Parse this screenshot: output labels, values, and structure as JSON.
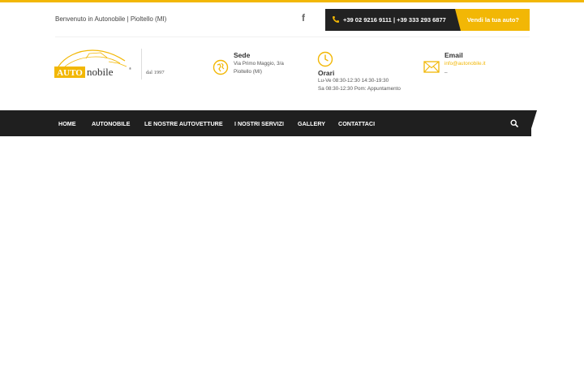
{
  "topbar": {
    "welcome": "Benvenuto in Autonobile | Pioltello (MI)",
    "facebook_glyph": "f",
    "phones": "+39 02 9216 9111 | +39 333 293 6877",
    "sell_label": "Vendi la tua auto?"
  },
  "logo": {
    "brand_auto": "AUTO",
    "brand_nobile": "nobile",
    "registered": "®",
    "since": "dal 1997"
  },
  "header": {
    "sede": {
      "title": "Sede",
      "line1": "Via Primo Maggio, 3/a",
      "line2": "Pioltello (MI)"
    },
    "orari": {
      "title": "Orari",
      "line1": "Lu-Ve 08:30-12:30 14:30-19:30",
      "line2": "Sa 08:30-12:30 Pom: Appuntamento"
    },
    "email": {
      "title": "Email",
      "address": "info@autonobile.it",
      "extra": "_"
    }
  },
  "nav": {
    "items": [
      "HOME",
      "AUTONOBILE",
      "LE NOSTRE AUTOVETTURE",
      "I NOSTRI SERVIZI",
      "GALLERY",
      "CONTATTACI"
    ]
  },
  "colors": {
    "accent": "#f2b705",
    "dark": "#1f1f1f"
  },
  "icons": [
    "facebook-icon",
    "phone-icon",
    "map-icon",
    "clock-icon",
    "envelope-icon",
    "search-icon"
  ]
}
